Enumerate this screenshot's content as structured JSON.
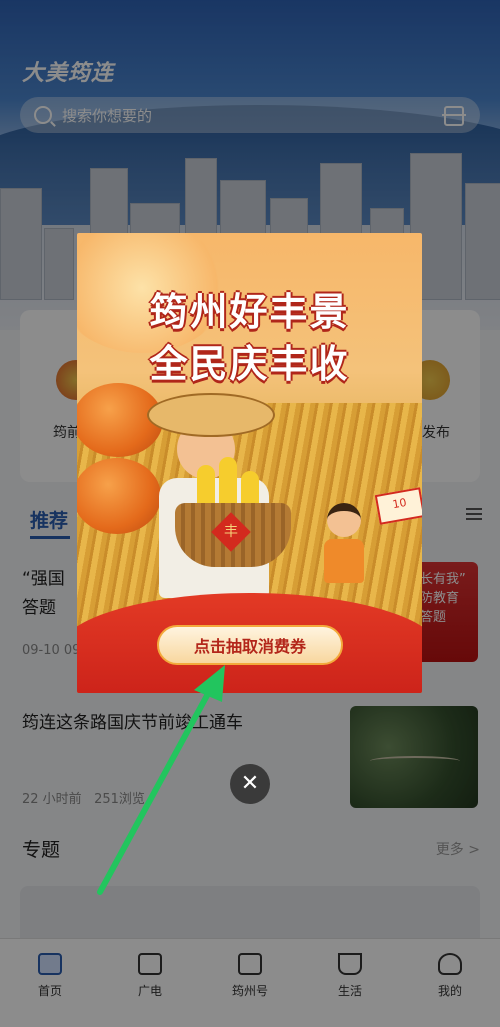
{
  "header": {
    "app_title": "大美筠连",
    "search_placeholder": "搜索你想要的"
  },
  "quick_entries": {
    "left_label": "筠前",
    "right_label": "发布"
  },
  "tabs": {
    "active": "推荐"
  },
  "news": [
    {
      "title": "“强国复兴有我”筠连教育答题",
      "title_visible": "“强国\n答题",
      "meta": "09-10 09",
      "thumb_text": "长有我”\n防教育\n答题"
    },
    {
      "title": "筠连这条路国庆节前竣工通车",
      "meta": "22 小时前   251浏览"
    }
  ],
  "section": {
    "title": "专题",
    "more": "更多 >"
  },
  "bottom_nav": [
    {
      "label": "首页",
      "icon": "home-icon",
      "active": true
    },
    {
      "label": "广电",
      "icon": "tv-icon",
      "active": false
    },
    {
      "label": "筠州号",
      "icon": "play-icon",
      "active": false
    },
    {
      "label": "生活",
      "icon": "cup-icon",
      "active": false
    },
    {
      "label": "我的",
      "icon": "user-icon",
      "active": false
    }
  ],
  "popup": {
    "title_line1": "筠州好丰景",
    "title_line2": "全民庆丰收",
    "badge": "丰",
    "ticket": "10",
    "cta": "点击抽取消费券",
    "close": "✕"
  },
  "colors": {
    "accent": "#2a5db0",
    "popup_red": "#d32a1e",
    "arrow": "#22c55e"
  }
}
